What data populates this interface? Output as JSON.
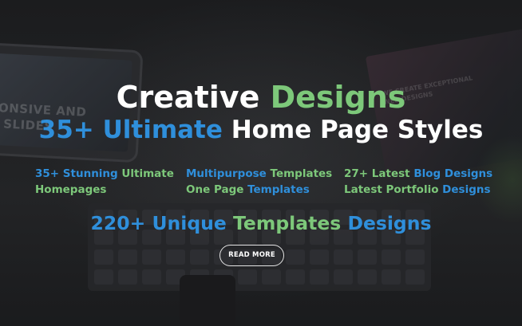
{
  "hero": {
    "title_line1": {
      "part1": "Creative",
      "part2": "Designs"
    },
    "title_line2": {
      "part1": "35+ Ultimate",
      "part2": "Home Page Styles"
    },
    "features": [
      {
        "line1": [
          "35+ Stunning",
          "Ultimate"
        ],
        "line2": [
          "Homepages"
        ]
      },
      {
        "line1": [
          "Multipurpose",
          "Templates"
        ],
        "line2": [
          "One Page",
          "Templates"
        ]
      },
      {
        "line1": [
          "27+ Latest",
          "Blog Designs"
        ],
        "line2": [
          "Latest Portfolio",
          "Designs"
        ]
      }
    ],
    "tagline": {
      "part1": "220+ Unique",
      "part2": "Templates",
      "part3": "Designs"
    },
    "cta_label": "READ MORE"
  },
  "background": {
    "tablet_text_line1": "PONSIVE AND",
    "tablet_text_line2": "H SLIDES",
    "screen_text_line1": "WE CREATE EXCEPTIONAL",
    "screen_text_line2": "WEB DESIGNS"
  },
  "colors": {
    "accent_green": "#7dc87a",
    "accent_blue": "#2f8fdb",
    "text_white": "#ffffff",
    "background": "#1e1f21"
  }
}
